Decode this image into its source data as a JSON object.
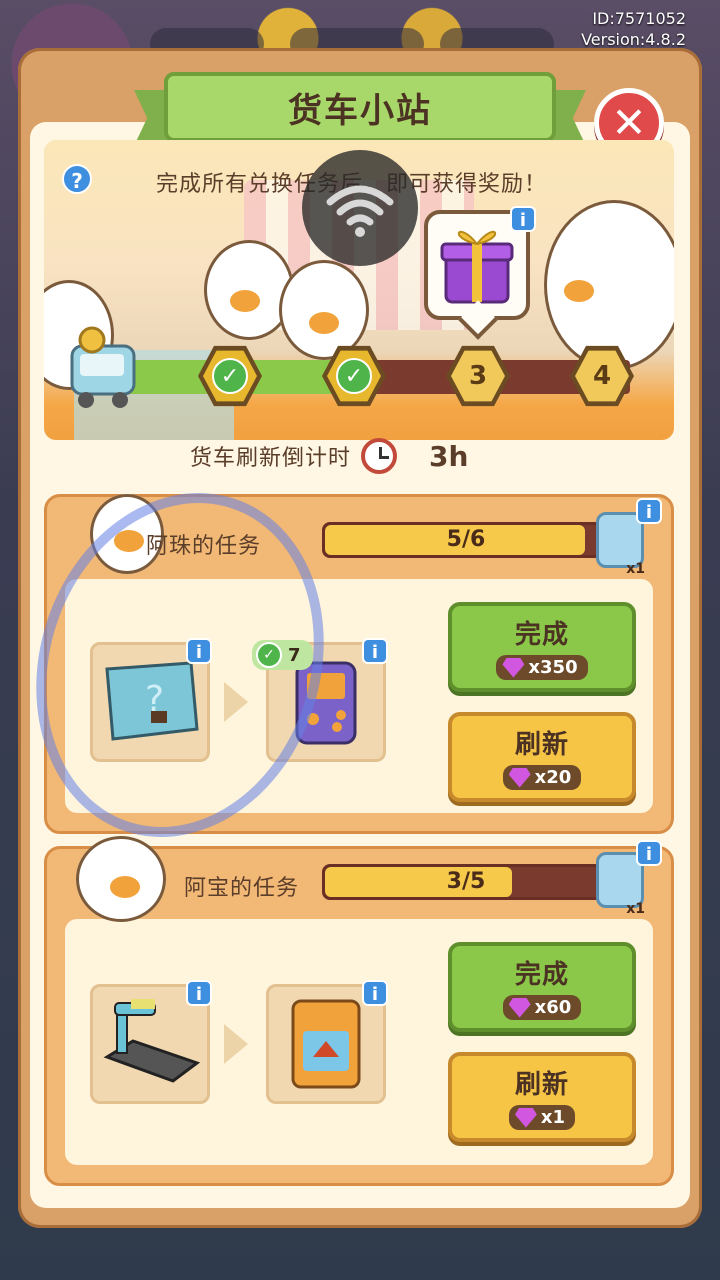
{
  "meta": {
    "id_text": "ID:7571052",
    "version_text": "Version:4.8.2"
  },
  "header": {
    "title": "货车小站"
  },
  "banner": {
    "hint": "完成所有兑换任务后，即可获得奖励！",
    "help_icon": "question-icon",
    "reward_icon": "gift-box-icon",
    "steps": [
      {
        "label": "",
        "state": "done"
      },
      {
        "label": "",
        "state": "done"
      },
      {
        "label": "3",
        "state": "pending"
      },
      {
        "label": "4",
        "state": "pending"
      }
    ],
    "progress": 0.5
  },
  "countdown": {
    "label": "货车刷新倒计时",
    "value": "3h"
  },
  "tasks": [
    {
      "title": "阿珠的任务",
      "progress_text": "5/6",
      "progress": 0.833,
      "reward_count": "x1",
      "item_from_icon": "mystery-blueprint-icon",
      "item_to_icon": "handheld-console-icon",
      "owned_count": "7",
      "complete_label": "完成",
      "complete_cost": "x350",
      "refresh_label": "刷新",
      "refresh_cost": "x20"
    },
    {
      "title": "阿宝的任务",
      "progress_text": "3/5",
      "progress": 0.6,
      "reward_count": "x1",
      "item_from_icon": "treadmill-icon",
      "item_to_icon": "game-cartridge-icon",
      "complete_label": "完成",
      "complete_cost": "x60",
      "refresh_label": "刷新",
      "refresh_cost": "x1"
    }
  ],
  "colors": {
    "accent_green": "#8bc84a",
    "accent_yellow": "#f7c546",
    "gem": "#d257e0",
    "info_blue": "#3f8fe0"
  }
}
